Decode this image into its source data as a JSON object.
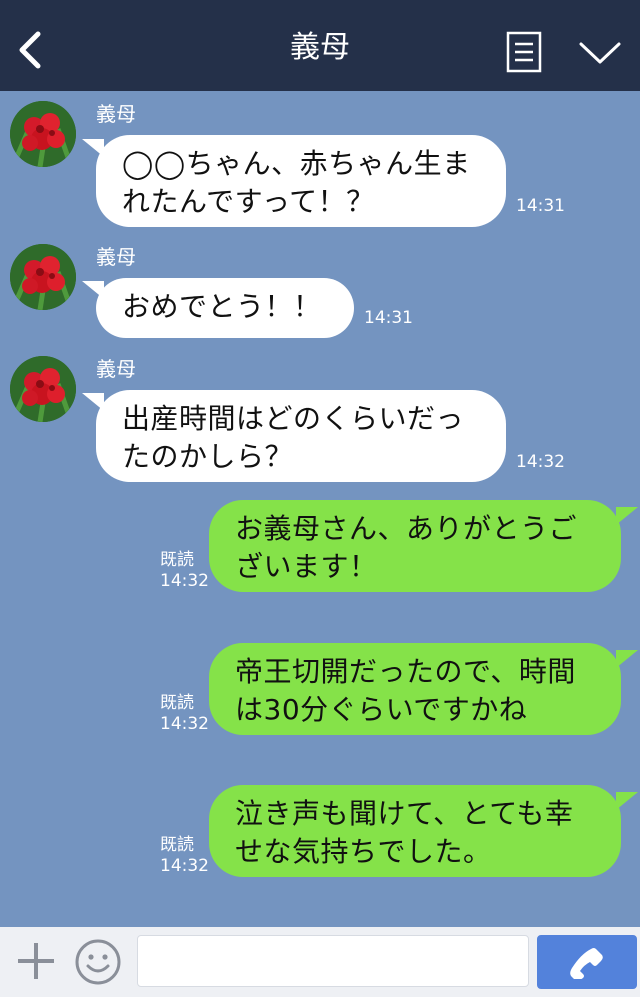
{
  "header": {
    "title": "義母",
    "back_icon": "back-chevron-icon",
    "menu_icon": "menu-list-icon",
    "more_icon": "chevron-down-icon"
  },
  "messages": [
    {
      "direction": "in",
      "sender": "義母",
      "lines": [
        "◯◯ちゃん、赤ちゃん生ま",
        "れたんですって！？"
      ],
      "time": "14:31"
    },
    {
      "direction": "in",
      "sender": "義母",
      "lines": [
        "おめでとう！！"
      ],
      "time": "14:31"
    },
    {
      "direction": "in",
      "sender": "義母",
      "lines": [
        "出産時間はどのくらいだっ",
        "たのかしら？"
      ],
      "time": "14:32"
    },
    {
      "direction": "out",
      "read": "既読",
      "lines": [
        "お義母さん、ありがとうご",
        "ざいます！"
      ],
      "time": "14:32"
    },
    {
      "direction": "out",
      "read": "既読",
      "lines": [
        "帝王切開だったので、時間",
        "は30分ぐらいですかね"
      ],
      "time": "14:32"
    },
    {
      "direction": "out",
      "read": "既読",
      "lines": [
        "泣き声も聞けて、とても幸",
        "せな気持ちでした。"
      ],
      "time": "14:32"
    }
  ],
  "footer": {
    "plus_icon": "plus-icon",
    "sticker_icon": "smiley-icon",
    "input_value": "",
    "send_icon": "phone-icon"
  },
  "colors": {
    "header_bg": "#243049",
    "chat_bg": "#7494c0",
    "incoming_bubble": "#ffffff",
    "outgoing_bubble": "#85e249",
    "send_button": "#5382db"
  }
}
